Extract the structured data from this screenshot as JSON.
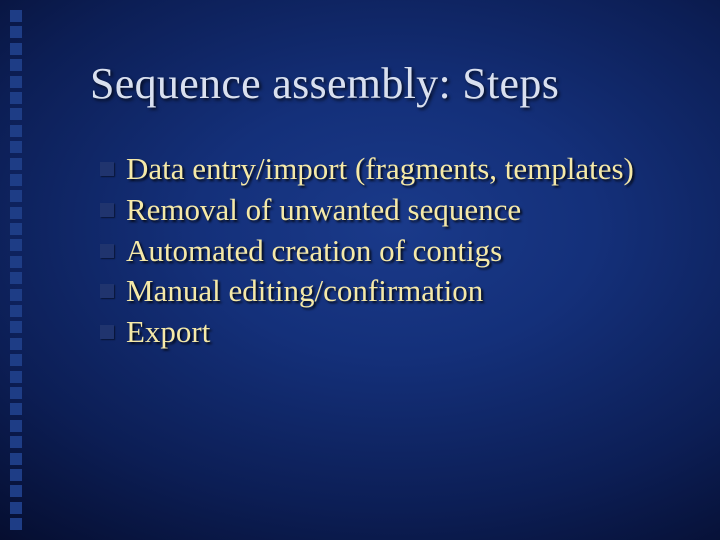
{
  "title": "Sequence assembly: Steps",
  "bullets": [
    "Data entry/import (fragments, templates)",
    "Removal of unwanted sequence",
    "Automated creation of contigs",
    "Manual editing/confirmation",
    "Export"
  ]
}
